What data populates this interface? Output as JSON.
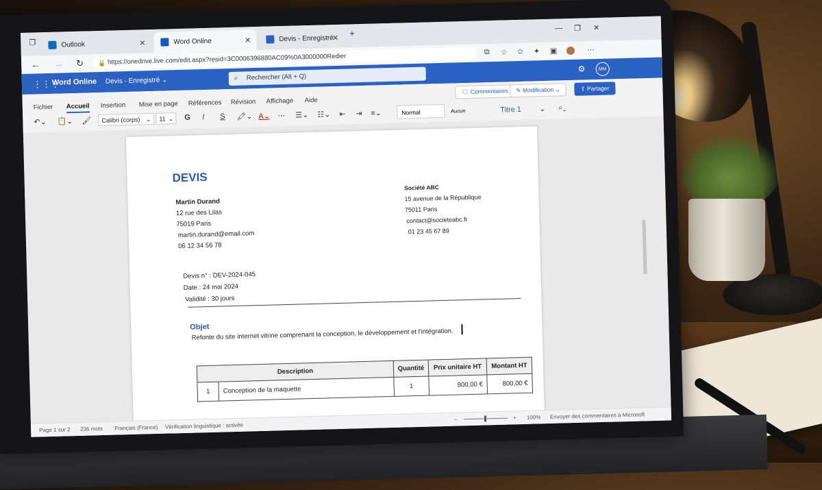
{
  "browser": {
    "tabs": [
      {
        "label": "Outlook",
        "icon": "outlook-icon",
        "color": "#0f6cbd"
      },
      {
        "label": "Word Online",
        "icon": "word-icon",
        "color": "#185abd"
      },
      {
        "label": "Devis - Enregistré",
        "icon": "edge-doc-icon",
        "color": "#2b62c2"
      }
    ],
    "url": "https://onedrive.live.com/edit.aspx?resid=3C0006396880AC09%0A3000000Redier"
  },
  "word": {
    "app_name": "Word Online",
    "doc_name": "Devis - Enregistré",
    "search_placeholder": "Rechercher (Alt + Q)",
    "avatar_initials": "MM",
    "accent": "#2b62c2"
  },
  "ribbon": {
    "tabs": [
      "Fichier",
      "Accueil",
      "Insertion",
      "Mise en page",
      "Références",
      "Révision",
      "Affichage",
      "Aide"
    ],
    "comments": "Commentaires",
    "mode": "Modification",
    "share": "Partager",
    "font": "Calibri (corps)",
    "size": "11",
    "bold": "G",
    "italic": "I",
    "underline": "S",
    "styles": [
      "Normal",
      "Aucun espacement",
      "Titre 1"
    ]
  },
  "doc": {
    "title": "DEVIS",
    "sender": {
      "name": "Martin Durand",
      "street": "12 rue des Lilas",
      "city": "75019 Paris",
      "email": "martin.durand@email.com",
      "phone": "06 12 34 56 78"
    },
    "client": {
      "name": "Société ABC",
      "street": "15 avenue de la République",
      "city": "75011 Paris",
      "email": "contact@societeabc.fr",
      "phone": "01 23 45 67 89"
    },
    "meta": {
      "number": "Devis n° : DEV-2024-045",
      "date": "Date : 24 mai 2024",
      "validity": "Validité : 30 jours"
    },
    "objet_heading": "Objet",
    "objet_text": "Refonte du site internet vitrine comprenant la conception, le développement et l'intégration.",
    "table": {
      "headers": [
        "Description",
        "Quantité",
        "Prix unitaire HT",
        "Montant HT"
      ],
      "rows": [
        {
          "num": "1",
          "description": "Conception de la maquette",
          "qty": "1",
          "unit": "800,00 €",
          "total": "800,00 €"
        }
      ]
    }
  },
  "status": {
    "page": "Page 1 sur 2",
    "words": "236 mots",
    "lang": "Français (France)",
    "check": "Vérification linguistique : activée",
    "zoom": "100%",
    "feedback": "Envoyer des commentaires à Microsoft"
  }
}
